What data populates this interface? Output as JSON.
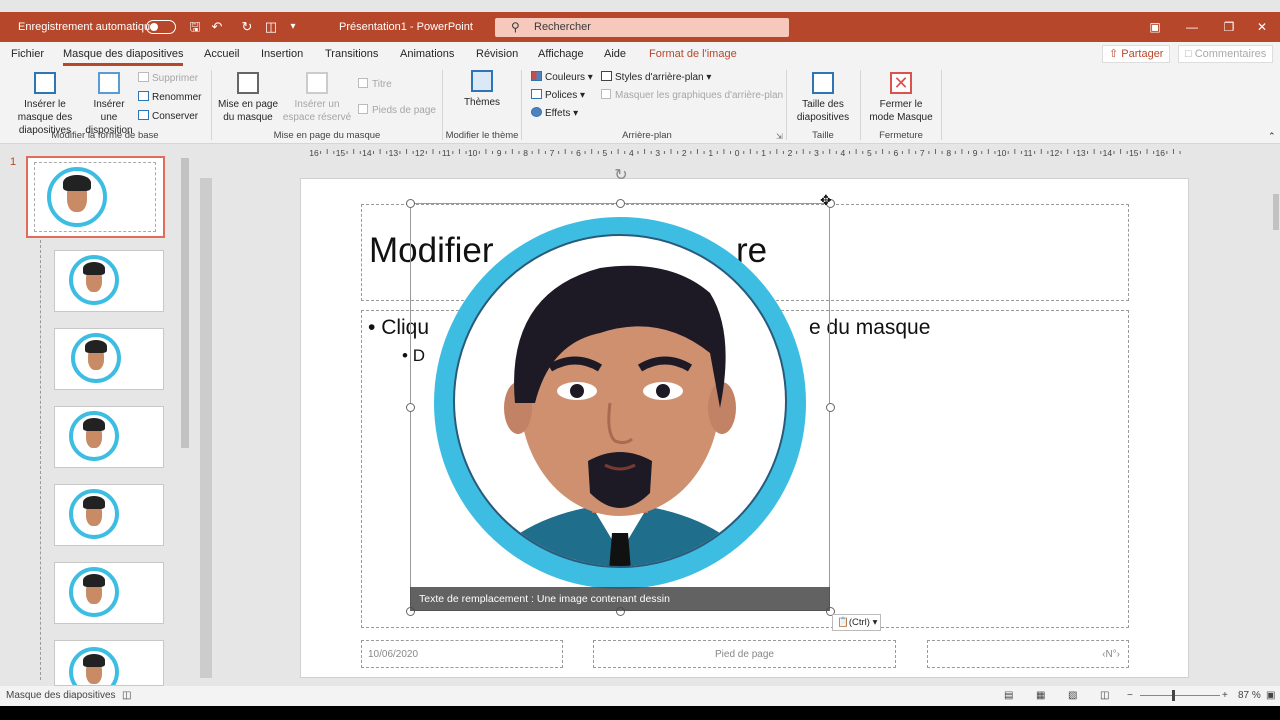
{
  "titlebar": {
    "autosave_label": "Enregistrement automatique",
    "doc_title": "Présentation1  -  PowerPoint",
    "search_placeholder": "Rechercher"
  },
  "tabs": [
    "Fichier",
    "Masque des diapositives",
    "Accueil",
    "Insertion",
    "Transitions",
    "Animations",
    "Révision",
    "Affichage",
    "Aide",
    "Format de l'image"
  ],
  "share": {
    "share_label": "Partager",
    "comments_label": "Commentaires"
  },
  "ribbon": {
    "insert_master": "Insérer le masque des diapositives",
    "insert_layout": "Insérer une disposition",
    "delete": "Supprimer",
    "rename": "Renommer",
    "preserve": "Conserver",
    "group1": "Modifier la forme de base",
    "master_layout": "Mise en page du masque",
    "insert_placeholder": "Insérer un espace réservé",
    "title_chk": "Titre",
    "footers_chk": "Pieds de page",
    "group2": "Mise en page du masque",
    "themes": "Thèmes",
    "group3": "Modifier le thème",
    "colors": "Couleurs",
    "fonts": "Polices",
    "effects": "Effets",
    "bg_styles": "Styles d'arrière-plan",
    "hide_bg": "Masquer les graphiques d'arrière-plan",
    "group4": "Arrière-plan",
    "slide_size": "Taille des diapositives",
    "group5": "Taille",
    "close_master": "Fermer le mode Masque",
    "group6": "Fermeture"
  },
  "thumbs": {
    "first_number": "1"
  },
  "slide": {
    "title_left": "Modifier",
    "title_right": "re",
    "bullet1_left": "Cliqu",
    "bullet1_right": "e du masque",
    "bullet2": "D",
    "alt_text": "Texte de remplacement : Une image contenant  dessin",
    "paste_label": "(Ctrl)",
    "footer_date": "10/06/2020",
    "footer_text": "Pied de page",
    "footer_num": "‹N°›"
  },
  "ruler": {
    "h_labels": [
      "16",
      "15",
      "14",
      "13",
      "12",
      "11",
      "10",
      "9",
      "8",
      "7",
      "6",
      "5",
      "4",
      "3",
      "2",
      "1",
      "0",
      "1",
      "2",
      "3",
      "4",
      "5",
      "6",
      "7",
      "8",
      "9",
      "10",
      "11",
      "12",
      "13",
      "14",
      "15",
      "16"
    ]
  },
  "status": {
    "mode_label": "Masque des diapositives",
    "zoom": "87 %"
  }
}
